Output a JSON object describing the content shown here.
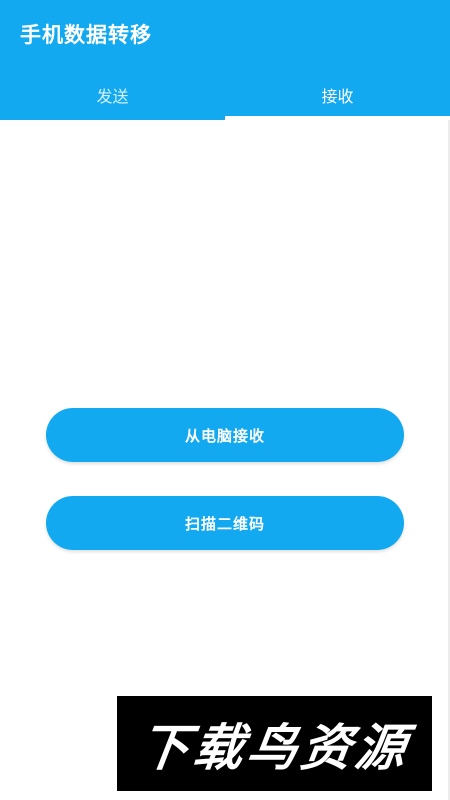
{
  "app": {
    "title": "手机数据转移"
  },
  "tabs": [
    {
      "label": "发送",
      "selected": false
    },
    {
      "label": "接收",
      "selected": true
    }
  ],
  "actions": {
    "receive_from_pc": "从电脑接收",
    "scan_qr": "扫描二维码"
  },
  "watermark": {
    "text": "下载鸟资源"
  },
  "colors": {
    "accent": "#12a9f0",
    "background": "#ffffff"
  }
}
